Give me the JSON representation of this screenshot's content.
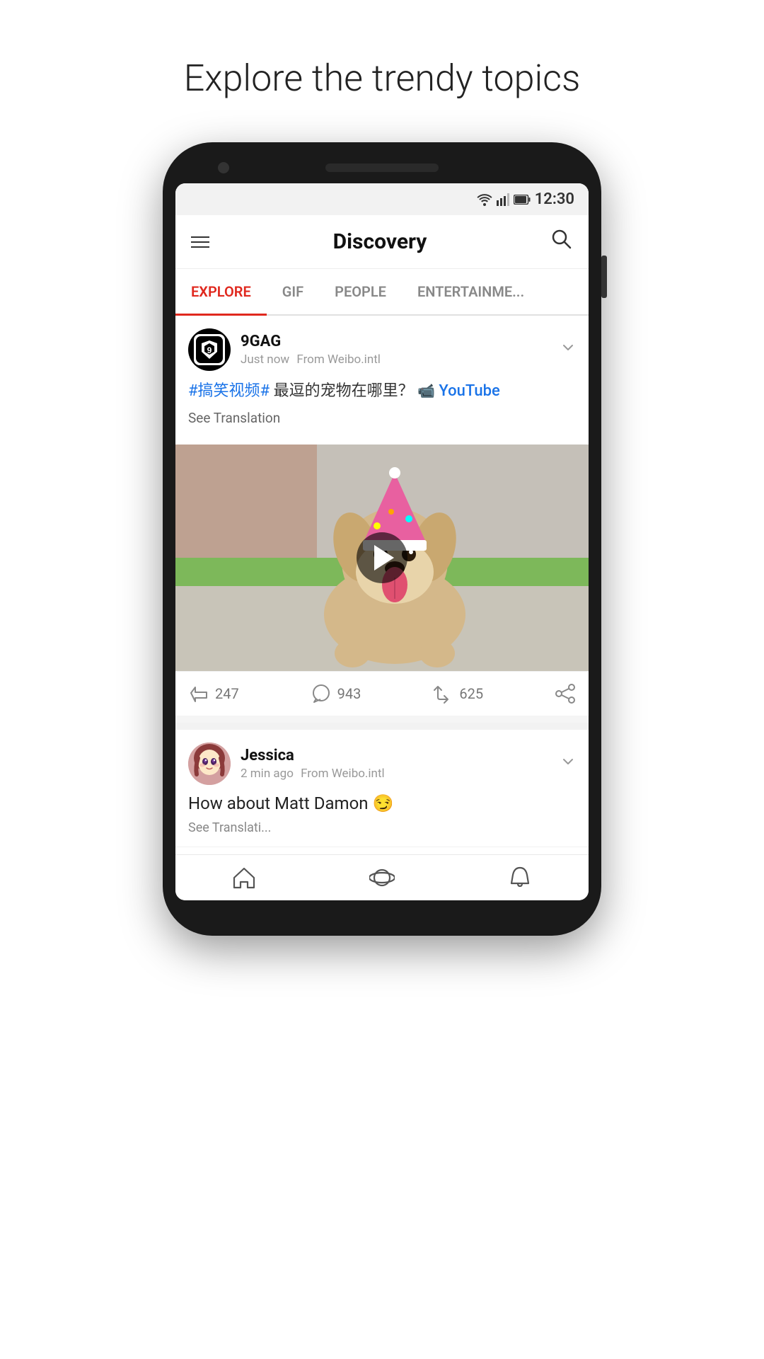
{
  "page": {
    "title": "Explore the trendy topics"
  },
  "status_bar": {
    "time": "12:30"
  },
  "header": {
    "title": "Discovery",
    "hamburger_label": "Menu",
    "search_label": "Search"
  },
  "tabs": [
    {
      "id": "explore",
      "label": "EXPLORE",
      "active": true
    },
    {
      "id": "gif",
      "label": "GIF",
      "active": false
    },
    {
      "id": "people",
      "label": "PEOPLE",
      "active": false
    },
    {
      "id": "entertainment",
      "label": "ENTERTAINME...",
      "active": false
    }
  ],
  "posts": [
    {
      "id": "post1",
      "author": "9GAG",
      "time_ago": "Just now",
      "source": "From Weibo.intl",
      "hashtag": "#搞笑视频#",
      "text_cn": " 最逗的宠物在哪里？",
      "yt_label": "YouTube",
      "see_translation": "See Translation",
      "likes": "247",
      "comments": "943",
      "reposts": "625"
    },
    {
      "id": "post2",
      "author": "Jessica",
      "time_ago": "2 min ago",
      "source": "From Weibo.intl",
      "text": "How about Matt Damon 😏",
      "see_translation": "See Translati..."
    }
  ],
  "bottom_nav": [
    {
      "id": "home",
      "icon": "home"
    },
    {
      "id": "discover",
      "icon": "planet"
    },
    {
      "id": "notifications",
      "icon": "bell"
    }
  ]
}
